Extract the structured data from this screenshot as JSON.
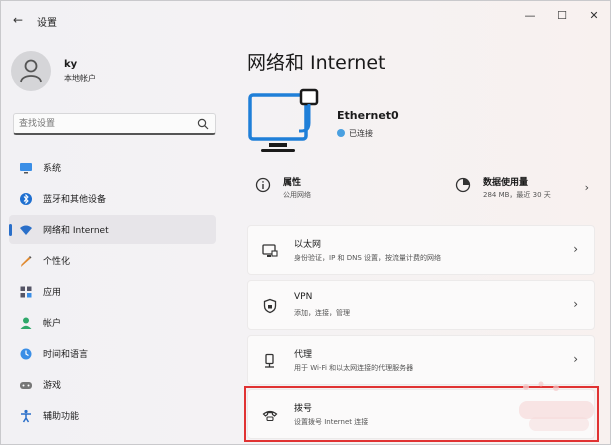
{
  "app": {
    "title": "设置"
  },
  "window_controls": {
    "minimize": "—",
    "maximize": "☐",
    "close": "✕"
  },
  "profile": {
    "name": "ky",
    "account_type": "本地帐户"
  },
  "search": {
    "placeholder": "查找设置"
  },
  "sidebar": {
    "items": [
      {
        "label": "系统",
        "icon": "monitor-icon",
        "active": false
      },
      {
        "label": "蓝牙和其他设备",
        "icon": "bluetooth-icon",
        "active": false
      },
      {
        "label": "网络和 Internet",
        "icon": "wifi-icon",
        "active": true
      },
      {
        "label": "个性化",
        "icon": "pen-icon",
        "active": false
      },
      {
        "label": "应用",
        "icon": "apps-icon",
        "active": false
      },
      {
        "label": "帐户",
        "icon": "account-icon",
        "active": false
      },
      {
        "label": "时间和语言",
        "icon": "globe-clock-icon",
        "active": false
      },
      {
        "label": "游戏",
        "icon": "gamepad-icon",
        "active": false
      },
      {
        "label": "辅助功能",
        "icon": "accessibility-icon",
        "active": false
      }
    ]
  },
  "main": {
    "title": "网络和 Internet",
    "device": {
      "name": "Ethernet0",
      "status": "已连接"
    },
    "properties": {
      "title": "属性",
      "subtitle": "公用网络"
    },
    "data_usage": {
      "title": "数据使用量",
      "subtitle": "284 MB，最近 30 天"
    },
    "cards": [
      {
        "title": "以太网",
        "subtitle": "身份验证，IP 和 DNS 设置，按流量计费的网络",
        "icon": "ethernet-icon"
      },
      {
        "title": "VPN",
        "subtitle": "添加，连接，管理",
        "icon": "vpn-shield-icon"
      },
      {
        "title": "代理",
        "subtitle": "用于 Wi-Fi 和以太网连接的代理服务器",
        "icon": "proxy-icon"
      },
      {
        "title": "拨号",
        "subtitle": "设置拨号 Internet 连接",
        "icon": "dialup-icon"
      }
    ]
  },
  "colors": {
    "accent": "#2a6fc9",
    "highlight": "#e03232",
    "connected": "#4aa0e0"
  }
}
